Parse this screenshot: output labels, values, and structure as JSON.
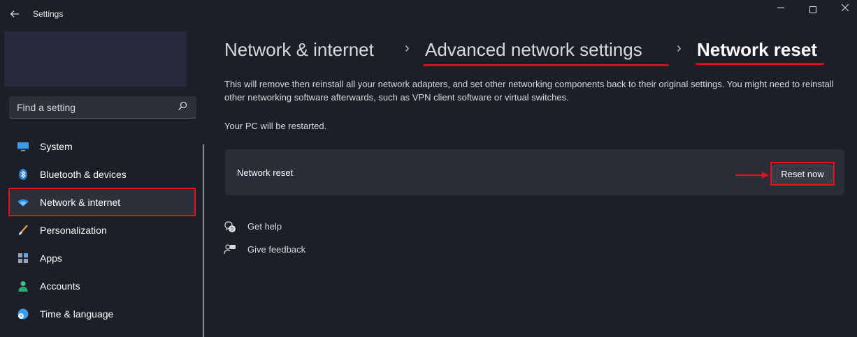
{
  "window": {
    "title": "Settings",
    "back_icon": "arrow-left-icon"
  },
  "search": {
    "placeholder": "Find a setting",
    "icon": "search-icon"
  },
  "sidebar": {
    "items": [
      {
        "label": "System",
        "icon": "monitor-icon",
        "selected": false
      },
      {
        "label": "Bluetooth & devices",
        "icon": "bluetooth-icon",
        "selected": false
      },
      {
        "label": "Network & internet",
        "icon": "wifi-icon",
        "selected": true
      },
      {
        "label": "Personalization",
        "icon": "brush-icon",
        "selected": false
      },
      {
        "label": "Apps",
        "icon": "apps-icon",
        "selected": false
      },
      {
        "label": "Accounts",
        "icon": "person-icon",
        "selected": false
      },
      {
        "label": "Time & language",
        "icon": "globe-clock-icon",
        "selected": false
      }
    ]
  },
  "breadcrumb": {
    "items": [
      "Network & internet",
      "Advanced network settings",
      "Network reset"
    ],
    "separator": "›"
  },
  "main": {
    "description": "This will remove then reinstall all your network adapters, and set other networking components back to their original settings. You might need to reinstall other networking software afterwards, such as VPN client software or virtual switches.",
    "restart_note": "Your PC will be restarted.",
    "card_label": "Network reset",
    "reset_button": "Reset now"
  },
  "help": {
    "get_help": "Get help",
    "give_feedback": "Give feedback"
  },
  "colors": {
    "background": "#1c1f28",
    "card": "#2b2e39",
    "annotation_red": "#e0141a",
    "accent_blue": "#3b8fe0"
  }
}
